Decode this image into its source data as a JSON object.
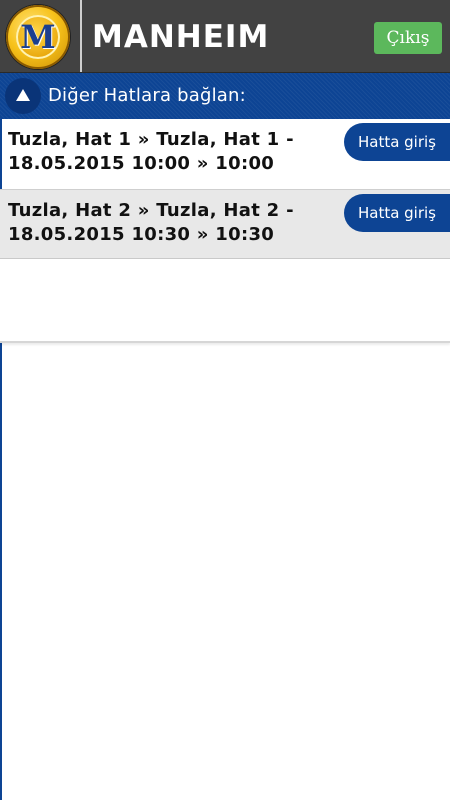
{
  "header": {
    "logo_letter": "M",
    "brand": "MANHEIM",
    "logout_label": "Çıkış"
  },
  "section": {
    "label": "Diğer Hatlara bağlan:",
    "toggle_icon": "triangle-up-icon"
  },
  "lines": [
    {
      "text": "Tuzla, Hat 1 » Tuzla, Hat 1 - 18.05.2015 10:00 » 10:00",
      "button_label": "Hatta giriş"
    },
    {
      "text": "Tuzla, Hat 2 » Tuzla, Hat 2 - 18.05.2015 10:30 » 10:30",
      "button_label": "Hatta giriş"
    }
  ],
  "colors": {
    "topbar": "#424242",
    "primary_blue": "#0d4494",
    "logout_green": "#5cb85c",
    "logo_gold": "#f7c21a"
  }
}
